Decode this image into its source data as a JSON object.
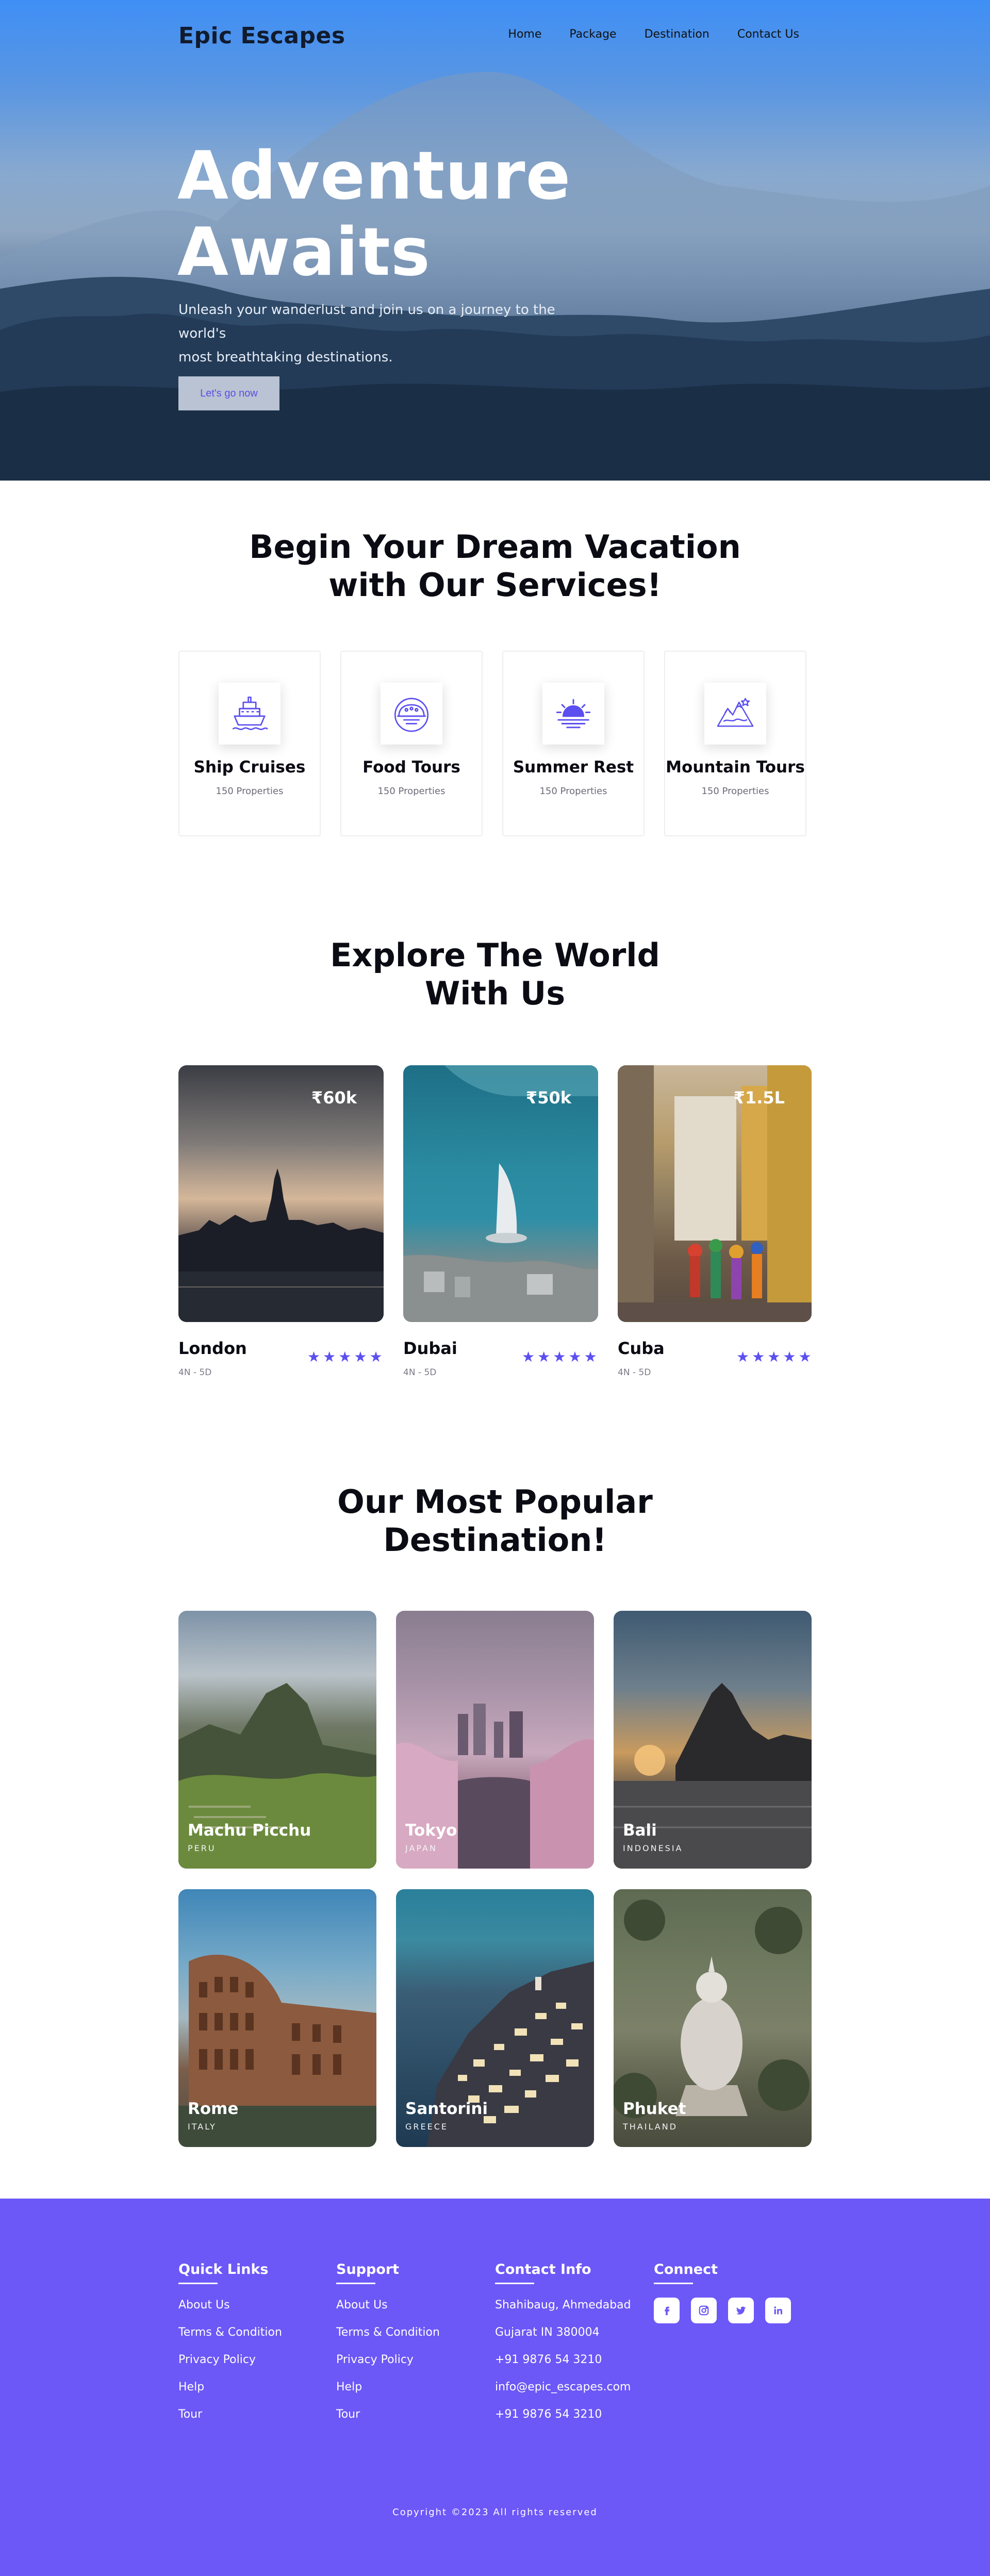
{
  "brand": "Epic Escapes",
  "nav": [
    "Home",
    "Package",
    "Destination",
    "Contact Us"
  ],
  "hero": {
    "title_line1": "Adventure",
    "title_line2": "Awaits",
    "subtitle_line1": "Unleash your wanderlust and join us on a journey to the world's",
    "subtitle_line2": "most breathtaking destinations.",
    "button": "Let's go now"
  },
  "services": {
    "title_line1": "Begin Your Dream Vacation",
    "title_line2": "with Our Services!",
    "items": [
      {
        "name": "Ship Cruises",
        "properties": "150 Properties",
        "icon": "ship-icon"
      },
      {
        "name": "Food Tours",
        "properties": "150 Properties",
        "icon": "food-icon"
      },
      {
        "name": "Summer Rest",
        "properties": "150 Properties",
        "icon": "sunset-icon"
      },
      {
        "name": "Mountain Tours",
        "properties": "150 Properties",
        "icon": "mountain-icon"
      }
    ]
  },
  "explore": {
    "title_line1": "Explore The World",
    "title_line2": "With Us",
    "items": [
      {
        "name": "London",
        "price": "₹60k",
        "duration": "4N - 5D",
        "rating": 5
      },
      {
        "name": "Dubai",
        "price": "₹50k",
        "duration": "4N - 5D",
        "rating": 5
      },
      {
        "name": "Cuba",
        "price": "₹1.5L",
        "duration": "4N - 5D",
        "rating": 5
      }
    ]
  },
  "popular": {
    "title_line1": "Our Most Popular",
    "title_line2": "Destination!",
    "items": [
      {
        "name": "Machu Picchu",
        "country": "PERU"
      },
      {
        "name": "Tokyo",
        "country": "JAPAN"
      },
      {
        "name": "Bali",
        "country": "INDONESIA"
      },
      {
        "name": "Rome",
        "country": "ITALY"
      },
      {
        "name": "Santorini",
        "country": "GREECE"
      },
      {
        "name": "Phuket",
        "country": "THAILAND"
      }
    ]
  },
  "footer": {
    "quick_links": {
      "title": "Quick Links",
      "links": [
        "About Us",
        "Terms & Condition",
        "Privacy Policy",
        "Help",
        "Tour"
      ]
    },
    "support": {
      "title": "Support",
      "links": [
        "About Us",
        "Terms & Condition",
        "Privacy Policy",
        "Help",
        "Tour"
      ]
    },
    "contact": {
      "title": "Contact Info",
      "lines": [
        "Shahibaug, Ahmedabad",
        "Gujarat IN 380004",
        "+91 9876 54 3210",
        "info@epic_escapes.com",
        "+91 9876 54 3210"
      ]
    },
    "connect": {
      "title": "Connect",
      "icons": [
        "facebook-icon",
        "instagram-icon",
        "twitter-icon",
        "linkedin-icon"
      ]
    },
    "copyright": "Copyright ©2023 All rights reserved"
  },
  "colors": {
    "accent": "#6c57f7",
    "star": "#5b4ff0",
    "hero_top": "#3f8ff5"
  }
}
